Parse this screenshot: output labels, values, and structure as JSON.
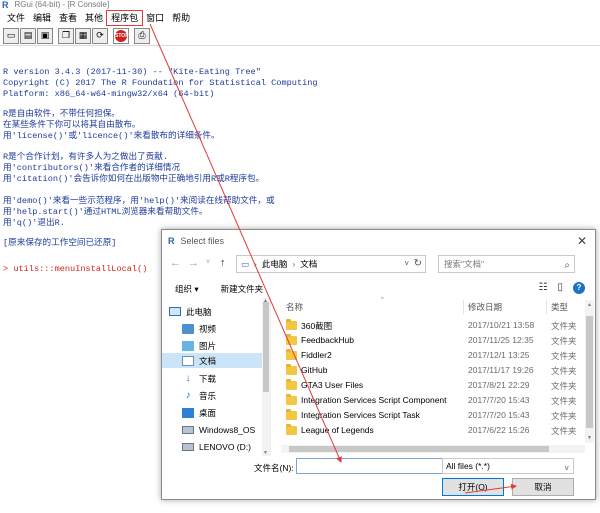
{
  "window": {
    "title": "RGui (64-bit) - [R Console]"
  },
  "menu": [
    "文件",
    "编辑",
    "查看",
    "其他",
    "程序包",
    "窗口",
    "帮助"
  ],
  "toolbar_icons": [
    "open-script-icon",
    "load-workspace-icon",
    "save-workspace-icon",
    "copy-icon",
    "paste-icon",
    "copy-paste-icon",
    "stop-icon",
    "print-icon"
  ],
  "toolbar_stop_label": "STOP",
  "console": {
    "lines": [
      "R version 3.4.3 (2017-11-30) -- \"Kite-Eating Tree\"",
      "Copyright (C) 2017 The R Foundation for Statistical Computing",
      "Platform: x86_64-w64-mingw32/x64 (64-bit)",
      "",
      "R是自由软件，不带任何担保。",
      "在某些条件下你可以将其自由散布。",
      "用'license()'或'licence()'来看散布的详细条件。",
      "",
      "R是个合作计划，有许多人为之做出了贡献.",
      "用'contributors()'来看合作者的详细情况",
      "用'citation()'会告诉你如何在出版物中正确地引用R或R程序包。",
      "",
      "用'demo()'来看一些示范程序，用'help()'来阅读在线帮助文件，或",
      "用'help.start()'通过HTML浏览器来看帮助文件。",
      "用'q()'退出R.",
      "",
      "[原来保存的工作空间已还原]",
      "",
      "> utils:::menuInstallLocal()"
    ]
  },
  "dialog": {
    "title": "Select files",
    "breadcrumb": [
      "此电脑",
      "文档"
    ],
    "search_placeholder": "搜索\"文档\"",
    "organize": "组织 ▾",
    "new_folder": "新建文件夹",
    "nav_items": [
      {
        "label": "此电脑",
        "icon": "pc-icon"
      },
      {
        "label": "视频",
        "icon": "video-folder-icon"
      },
      {
        "label": "图片",
        "icon": "pictures-folder-icon"
      },
      {
        "label": "文档",
        "icon": "documents-folder-icon"
      },
      {
        "label": "下载",
        "icon": "download-icon"
      },
      {
        "label": "音乐",
        "icon": "music-icon"
      },
      {
        "label": "桌面",
        "icon": "desktop-folder-icon"
      },
      {
        "label": "Windows8_OS",
        "icon": "drive-icon"
      },
      {
        "label": "LENOVO (D:)",
        "icon": "drive-icon"
      }
    ],
    "selected_nav": "文档",
    "columns": {
      "name": "名称",
      "date": "修改日期",
      "type": "类型"
    },
    "files": [
      {
        "name": "360截图",
        "date": "2017/10/21 13:58",
        "type": "文件夹"
      },
      {
        "name": "FeedbackHub",
        "date": "2017/11/25 12:35",
        "type": "文件夹"
      },
      {
        "name": "Fiddler2",
        "date": "2017/12/1 13:25",
        "type": "文件夹"
      },
      {
        "name": "GitHub",
        "date": "2017/11/17 19:26",
        "type": "文件夹"
      },
      {
        "name": "GTA3 User Files",
        "date": "2017/8/21 22:29",
        "type": "文件夹"
      },
      {
        "name": "Integration Services Script Component",
        "date": "2017/7/20 15:43",
        "type": "文件夹"
      },
      {
        "name": "Integration Services Script Task",
        "date": "2017/7/20 15:43",
        "type": "文件夹"
      },
      {
        "name": "League of Legends",
        "date": "2017/6/22 15:26",
        "type": "文件夹"
      }
    ],
    "filename_label": "文件名(N):",
    "filename_value": "",
    "filetype": "All files (*.*)",
    "open_button": "打开(O)",
    "cancel_button": "取消"
  },
  "colors": {
    "console_text": "#1f3c9a",
    "console_red": "#d8241c",
    "annotation_red": "#e03b3b",
    "selection": "#cce4f7"
  }
}
